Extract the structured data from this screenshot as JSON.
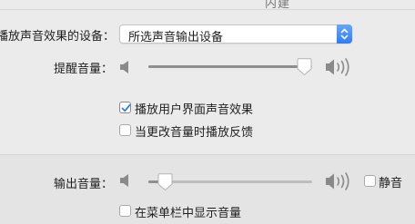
{
  "header": {
    "tab_title": "内建"
  },
  "output_device": {
    "label": "播放声音效果的设备：",
    "selected": "所选声音输出设备"
  },
  "alert_volume": {
    "label": "提醒音量：",
    "level": 0.95
  },
  "options": {
    "play_ui_sounds": {
      "label": "播放用户界面声音效果",
      "checked": true
    },
    "play_feedback": {
      "label": "当更改音量时播放反馈",
      "checked": false
    }
  },
  "output_volume": {
    "label": "输出音量：",
    "level": 0.1,
    "mute_label": "静音",
    "mute_checked": false
  },
  "menubar": {
    "label": "在菜单栏中显示音量",
    "checked": false
  },
  "icons": {
    "speaker_low": "speaker-low-icon",
    "speaker_high": "speaker-high-icon",
    "check": "checkmark-icon",
    "stepper": "chevron-updown-icon"
  },
  "colors": {
    "accent": "#2f7cf6",
    "check": "#2f7cf6"
  }
}
